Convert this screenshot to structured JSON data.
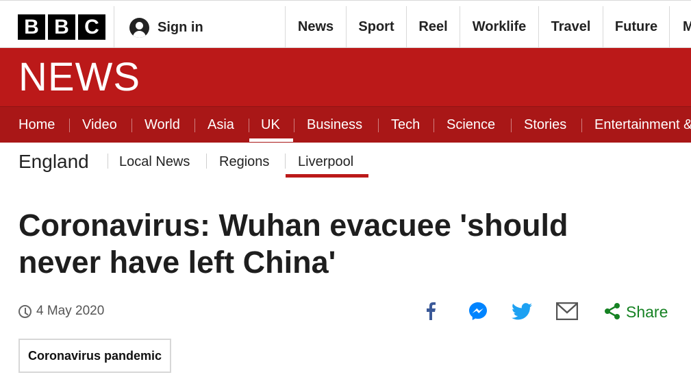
{
  "brand": {
    "logo_letters": [
      "B",
      "B",
      "C"
    ],
    "news_wordmark": "NEWS"
  },
  "topbar": {
    "signin_label": "Sign in",
    "items": [
      {
        "label": "News"
      },
      {
        "label": "Sport"
      },
      {
        "label": "Reel"
      },
      {
        "label": "Worklife"
      },
      {
        "label": "Travel"
      },
      {
        "label": "Future"
      },
      {
        "label": "M"
      }
    ]
  },
  "mainnav": {
    "active": "UK",
    "items": [
      {
        "label": "Home"
      },
      {
        "label": "Video"
      },
      {
        "label": "World"
      },
      {
        "label": "Asia"
      },
      {
        "label": "UK"
      },
      {
        "label": "Business"
      },
      {
        "label": "Tech"
      },
      {
        "label": "Science"
      },
      {
        "label": "Stories"
      },
      {
        "label": "Entertainment &"
      }
    ]
  },
  "subnav": {
    "title": "England",
    "active": "Liverpool",
    "items": [
      {
        "label": "Local News"
      },
      {
        "label": "Regions"
      },
      {
        "label": "Liverpool"
      }
    ]
  },
  "article": {
    "headline": "Coronavirus: Wuhan evacuee 'should never have left China'",
    "date": "4 May 2020",
    "tag": "Coronavirus pandemic"
  },
  "share": {
    "label": "Share",
    "icons": [
      "facebook-icon",
      "messenger-icon",
      "twitter-icon",
      "email-icon",
      "share-icon"
    ]
  },
  "colors": {
    "brand_red": "#bb1919",
    "nav_red": "#a91717",
    "facebook": "#3b5998",
    "messenger": "#0084ff",
    "twitter": "#1da1f2",
    "email": "#555555",
    "share_green": "#168223"
  }
}
